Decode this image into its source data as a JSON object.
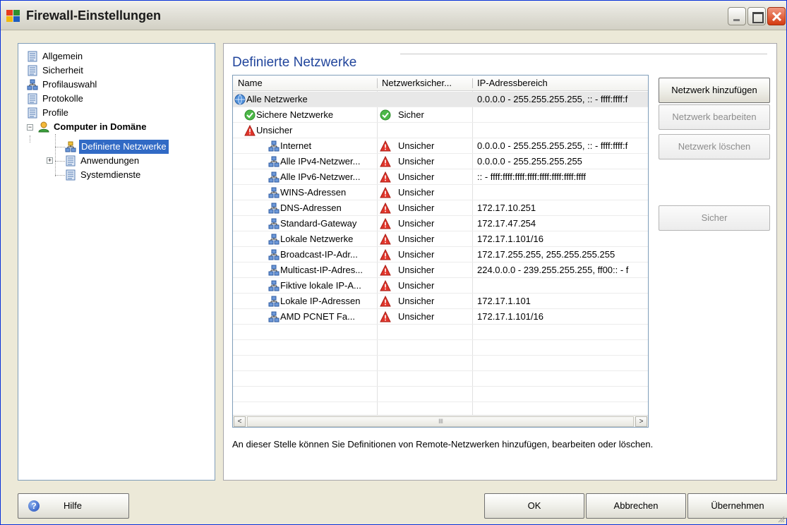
{
  "window": {
    "title": "Firewall-Einstellungen",
    "accent": "#0831d9",
    "selection_color": "#316ac5",
    "heading_color": "#21459c"
  },
  "tree": {
    "items": [
      {
        "label": "Allgemein",
        "icon": "page-icon"
      },
      {
        "label": "Sicherheit",
        "icon": "page-icon"
      },
      {
        "label": "Profilauswahl",
        "icon": "network-icon"
      },
      {
        "label": "Protokolle",
        "icon": "page-icon"
      },
      {
        "label": "Profile",
        "icon": "page-icon"
      },
      {
        "label": "Computer in Domäne",
        "icon": "user-icon"
      },
      {
        "label": "Definierte Netzwerke",
        "icon": "network-icon"
      },
      {
        "label": "Anwendungen",
        "icon": "page-icon"
      },
      {
        "label": "Systemdienste",
        "icon": "page-icon"
      }
    ],
    "expand_minus": "−",
    "expand_plus": "+"
  },
  "main": {
    "title": "Definierte Netzwerke",
    "columns": [
      "Name",
      "Netzwerksicher...",
      "IP-Adressbereich"
    ],
    "rows": [
      {
        "name": "Alle Netzwerke",
        "security": "",
        "ip": "0.0.0.0 - 255.255.255.255, :: - ffff:ffff:f",
        "icon": "globe-icon"
      },
      {
        "name": "Sichere Netzwerke",
        "security": "Sicher",
        "ip": "",
        "icon": "check-icon"
      },
      {
        "name": "Unsicher",
        "security": "",
        "ip": "",
        "icon": "warning-icon"
      },
      {
        "name": "Internet",
        "security": "Unsicher",
        "ip": "0.0.0.0 - 255.255.255.255, :: - ffff:ffff:f",
        "icon": "network-icon"
      },
      {
        "name": "Alle IPv4-Netzwer...",
        "security": "Unsicher",
        "ip": "0.0.0.0 - 255.255.255.255",
        "icon": "network-icon"
      },
      {
        "name": "Alle IPv6-Netzwer...",
        "security": "Unsicher",
        "ip": ":: - ffff:ffff:ffff:ffff:ffff:ffff:ffff:ffff",
        "icon": "network-icon"
      },
      {
        "name": "WINS-Adressen",
        "security": "Unsicher",
        "ip": "",
        "icon": "network-icon"
      },
      {
        "name": "DNS-Adressen",
        "security": "Unsicher",
        "ip": "172.17.10.251",
        "icon": "network-icon"
      },
      {
        "name": "Standard-Gateway",
        "security": "Unsicher",
        "ip": "172.17.47.254",
        "icon": "network-icon"
      },
      {
        "name": "Lokale Netzwerke",
        "security": "Unsicher",
        "ip": "172.17.1.101/16",
        "icon": "network-icon"
      },
      {
        "name": "Broadcast-IP-Adr...",
        "security": "Unsicher",
        "ip": "172.17.255.255, 255.255.255.255",
        "icon": "network-icon"
      },
      {
        "name": "Multicast-IP-Adres...",
        "security": "Unsicher",
        "ip": "224.0.0.0 - 239.255.255.255, ff00:: - f",
        "icon": "network-icon"
      },
      {
        "name": "Fiktive lokale IP-A...",
        "security": "Unsicher",
        "ip": "",
        "icon": "network-icon"
      },
      {
        "name": "Lokale IP-Adressen",
        "security": "Unsicher",
        "ip": "172.17.1.101",
        "icon": "network-icon"
      },
      {
        "name": "AMD PCNET Fa...",
        "security": "Unsicher",
        "ip": "172.17.1.101/16",
        "icon": "network-icon"
      }
    ],
    "scroll_left": "<",
    "scroll_right": ">",
    "scroll_grip": "IIII",
    "description": "An dieser Stelle können Sie Definitionen von Remote-Netzwerken hinzufügen, bearbeiten oder löschen."
  },
  "side_buttons": {
    "add": "Netzwerk hinzufügen",
    "edit": "Netzwerk bearbeiten",
    "delete": "Netzwerk löschen",
    "secure": "Sicher"
  },
  "footer": {
    "help": "Hilfe",
    "ok": "OK",
    "cancel": "Abbrechen",
    "apply": "Übernehmen"
  }
}
